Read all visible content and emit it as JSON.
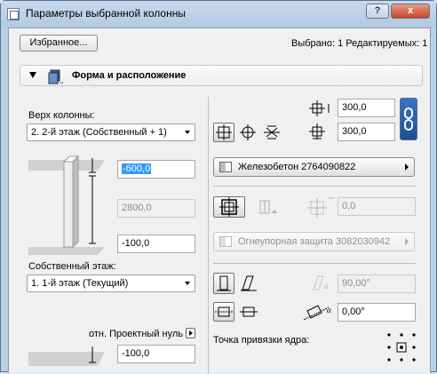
{
  "window": {
    "title": "Параметры выбранной колонны",
    "help_label": "?",
    "close_label": "x"
  },
  "toolbar": {
    "favorites_label": "Избранное...",
    "selection_info": "Выбрано: 1 Редактируемых: 1"
  },
  "section": {
    "title": "Форма и расположение"
  },
  "top": {
    "label": "Верх колонны:",
    "value": "2. 2-й этаж (Собственный + 1)",
    "offset_value": "-600,0",
    "height_value": "2800,0"
  },
  "bottom": {
    "offset_value": "-100,0",
    "label": "Собственный этаж:",
    "value": "1. 1-й этаж (Текущий)",
    "ref_label": "отн. Проектный нуль",
    "ref_value": "-100,0"
  },
  "size": {
    "width_value": "300,0",
    "depth_value": "300,0"
  },
  "material": {
    "label": "Железобетон 2764090822"
  },
  "veneer": {
    "thickness_value": "0,0",
    "label": "Огнеупорная защита 3082030942"
  },
  "slant": {
    "angle_value": "90,00°",
    "rotation_value": "0,00°"
  },
  "anchor": {
    "label": "Точка привязки ядра:"
  },
  "colors": {
    "window_frame": "#bcd0e6",
    "client": "#f0f0f0",
    "selection": "#3399ff",
    "close": "#c9442a",
    "link": "#1f4f92"
  }
}
